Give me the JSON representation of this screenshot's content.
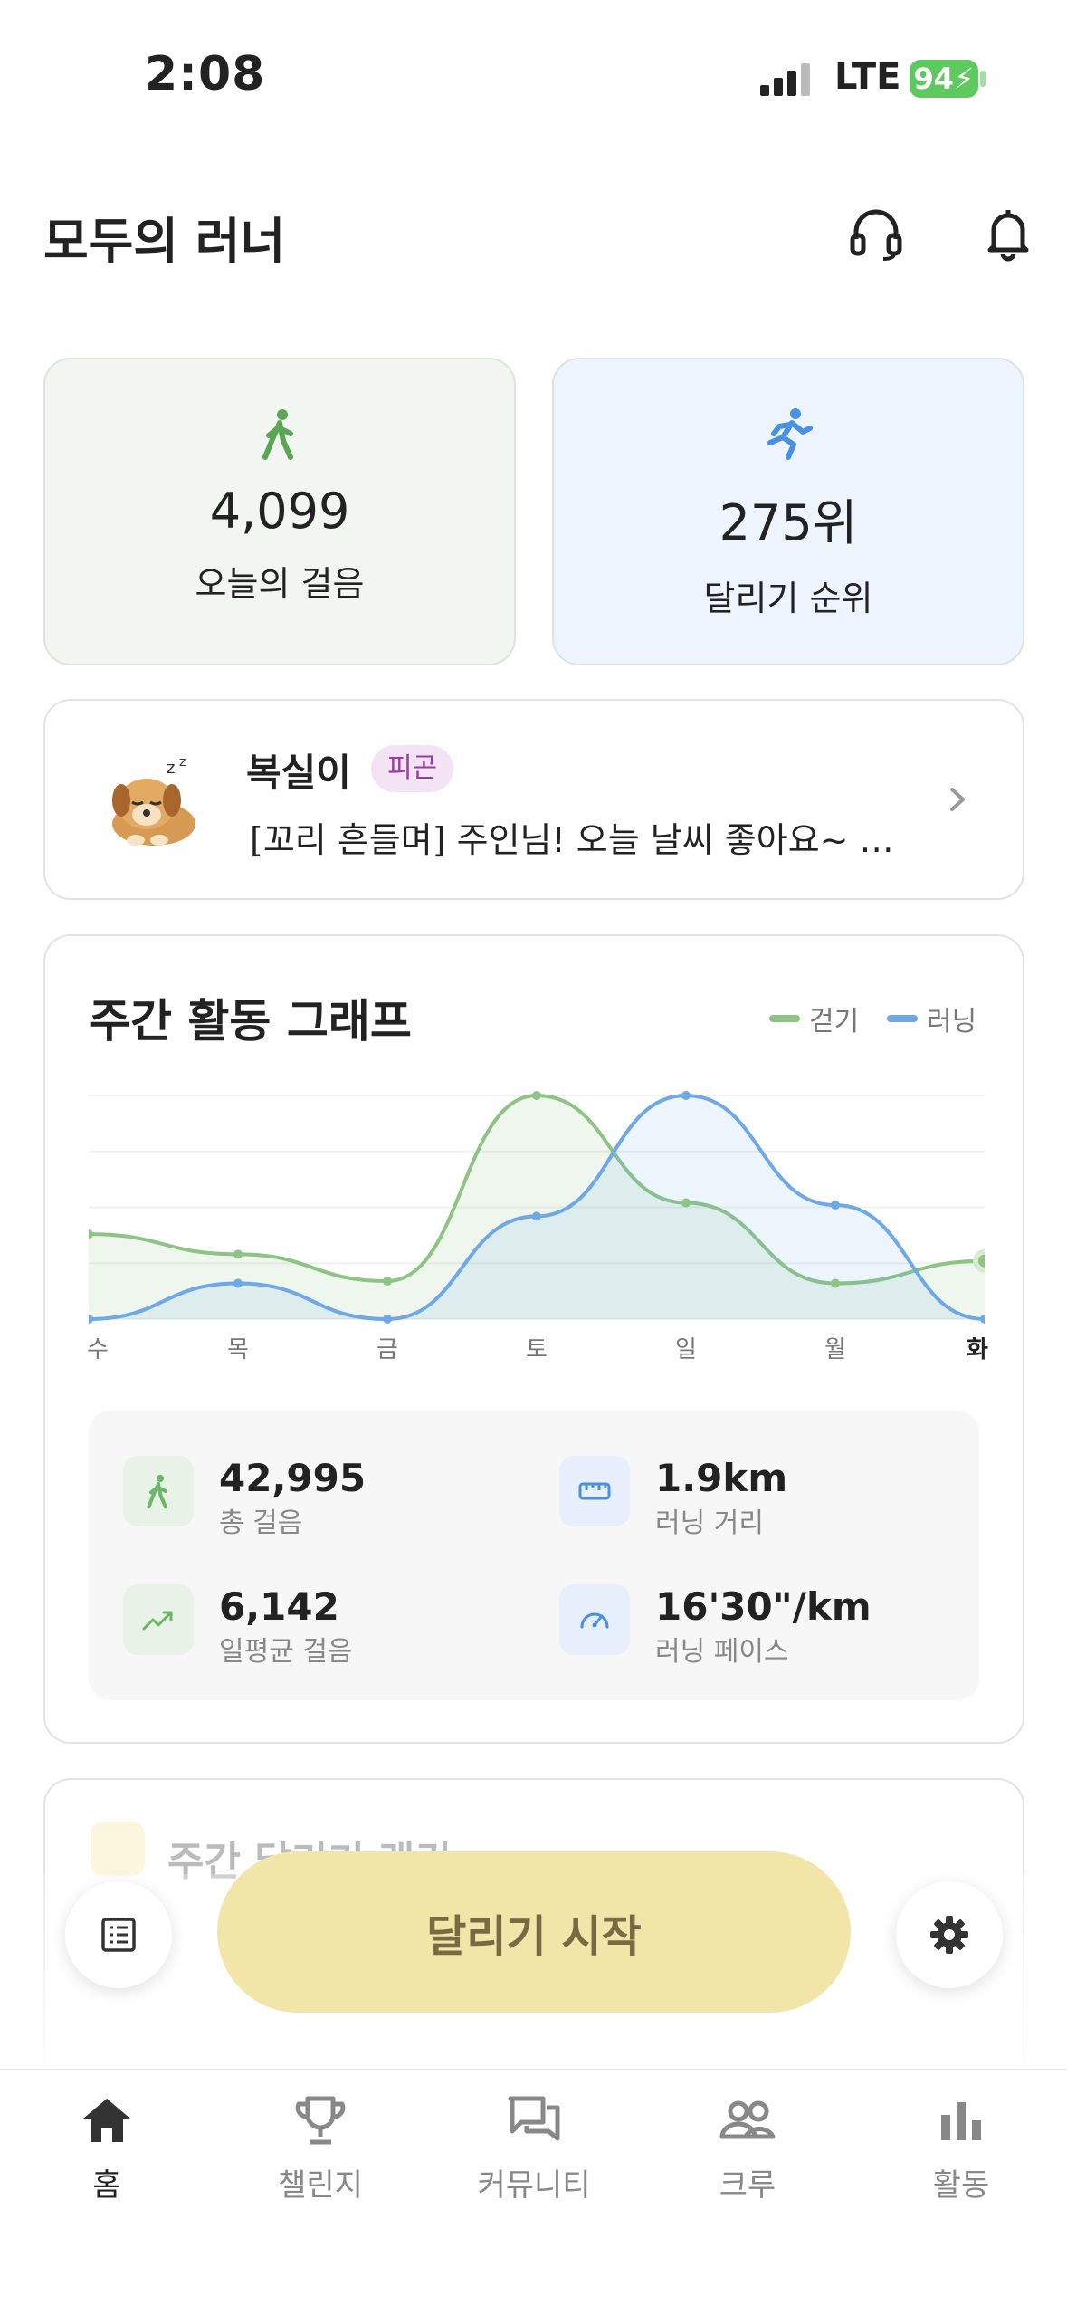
{
  "status_bar": {
    "time": "2:08",
    "network": "LTE",
    "battery": "94"
  },
  "header": {
    "title": "모두의 러너",
    "icons": [
      "headset-icon",
      "bell-icon"
    ]
  },
  "stats": [
    {
      "value": "4,099",
      "label": "오늘의 걸음",
      "icon": "walk-icon",
      "color": "#5aa655",
      "bg": "#f1f6f0"
    },
    {
      "value": "275위",
      "label": "달리기 순위",
      "icon": "run-icon",
      "color": "#4a90e2",
      "bg": "#eef4fd"
    }
  ],
  "pet": {
    "name": "복실이",
    "badge": "피곤",
    "message": "[꼬리 흔들며] 주인님! 오늘 날씨 좋아요~ 바…"
  },
  "weekly": {
    "title": "주간 활동 그래프",
    "legend": {
      "walk": "걷기",
      "run": "러닝"
    },
    "colors": {
      "walk": "#8dc484",
      "run": "#6fa8e6"
    },
    "summary": [
      {
        "value": "42,995",
        "label": "총 걸음",
        "icon": "walk-icon"
      },
      {
        "value": "1.9km",
        "label": "러닝 거리",
        "icon": "ruler-icon"
      },
      {
        "value": "6,142",
        "label": "일평균 걸음",
        "icon": "trend-icon"
      },
      {
        "value": "16'30\"/km",
        "label": "러닝 페이스",
        "icon": "gauge-icon"
      }
    ]
  },
  "chart_data": {
    "type": "area",
    "categories": [
      "수",
      "목",
      "금",
      "토",
      "일",
      "월",
      "화"
    ],
    "highlight": "화",
    "series": [
      {
        "name": "걷기",
        "values": [
          0.38,
          0.29,
          0.17,
          1.0,
          0.52,
          0.16,
          0.26
        ]
      },
      {
        "name": "러닝",
        "values": [
          0.0,
          0.16,
          0.0,
          0.46,
          1.0,
          0.51,
          0.0
        ]
      }
    ],
    "ylim": [
      0,
      1
    ],
    "grid": true
  },
  "ranking": {
    "title": "주간 달리기 랭킹"
  },
  "start_button": {
    "label": "달리기 시작"
  },
  "tabs": [
    {
      "label": "홈",
      "icon": "home-icon",
      "active": true
    },
    {
      "label": "챌린지",
      "icon": "trophy-icon",
      "active": false
    },
    {
      "label": "커뮤니티",
      "icon": "chat-icon",
      "active": false
    },
    {
      "label": "크루",
      "icon": "people-icon",
      "active": false
    },
    {
      "label": "활동",
      "icon": "bar-chart-icon",
      "active": false
    }
  ]
}
